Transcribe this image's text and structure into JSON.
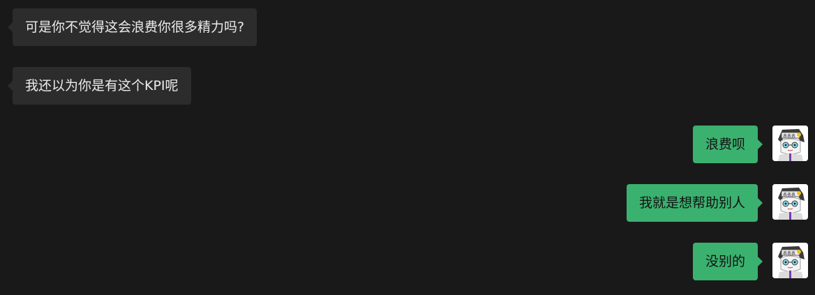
{
  "messages": [
    {
      "direction": "incoming",
      "text": "可是你不觉得这会浪费你很多精力吗?"
    },
    {
      "direction": "incoming",
      "text": "我还以为你是有这个KPI呢"
    },
    {
      "direction": "outgoing",
      "text": "浪费呗",
      "avatar_icon": "cartoon-avatar-icon"
    },
    {
      "direction": "outgoing",
      "text": "我就是想帮助别人",
      "avatar_icon": "cartoon-avatar-icon"
    },
    {
      "direction": "outgoing",
      "text": "没别的",
      "avatar_icon": "cartoon-avatar-icon"
    }
  ],
  "colors": {
    "background": "#191919",
    "incoming_bubble": "#2c2c2c",
    "outgoing_bubble": "#3bb16f",
    "incoming_text": "#ececec",
    "outgoing_text": "#121212"
  }
}
